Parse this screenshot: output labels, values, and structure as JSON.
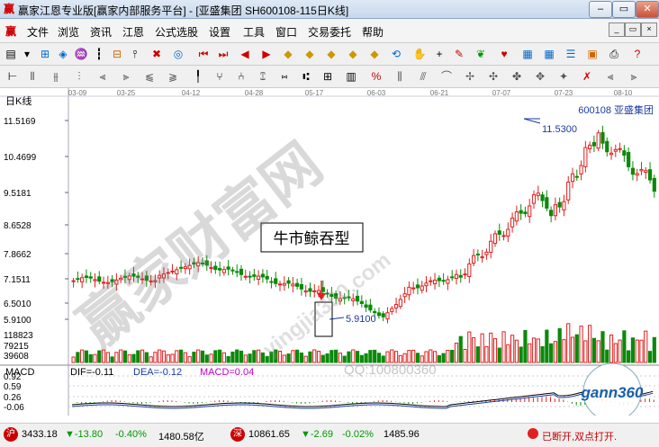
{
  "window": {
    "title": "赢家江恩专业版[赢家内部服务平台] - [亚盛集团  SH600108-115日K线]",
    "app_icon": "赢",
    "minimize": "–",
    "maximize": "▭",
    "close": "✕"
  },
  "menu": {
    "items": [
      "文件",
      "浏览",
      "资讯",
      "江恩",
      "公式选股",
      "设置",
      "工具",
      "窗口",
      "交易委托",
      "帮助"
    ],
    "mdi_buttons": [
      "_",
      "▭",
      "×"
    ]
  },
  "chart": {
    "period_label": "日K线",
    "stock_label": "600108  亚盛集团",
    "date_ticks": [
      "03-09",
      "03-25",
      "04-12",
      "04-28",
      "05-17",
      "06-03",
      "06-21",
      "07-07",
      "07-23",
      "08-10"
    ],
    "price_ticks": [
      "11.5169",
      "10.4699",
      "9.5181",
      "8.6528",
      "7.8662",
      "7.1511",
      "6.5010",
      "5.9100"
    ],
    "volume_ticks": [
      "118823",
      "79215",
      "39608"
    ],
    "high_annotation": "11.5300",
    "low_annotation": "5.9100",
    "pattern_label": "牛市鲸吞型",
    "watermark": "赢家财富网",
    "watermark_url": "yingjia360.com",
    "qq_text": "QQ:100800360",
    "logo_text": "gann360",
    "candle_up_color": "#e02020",
    "candle_down_color": "#0a8a0a"
  },
  "macd": {
    "label": "MACD",
    "dif": "DIF=-0.11",
    "dea": "DEA=-0.12",
    "macd": "MACD=0.04",
    "ticks": [
      "0.92",
      "0.59",
      "0.26",
      "-0.06"
    ]
  },
  "status": {
    "index1_value": "3433.18",
    "index1_change": "▼-13.80",
    "index1_pct": "-0.40%",
    "index1_amount": "1480.58亿",
    "index2_value": "10861.65",
    "index2_change": "▼-2.69",
    "index2_pct": "-0.02%",
    "index2_amount": "1485.96",
    "notice": "已断开,双点打开."
  }
}
